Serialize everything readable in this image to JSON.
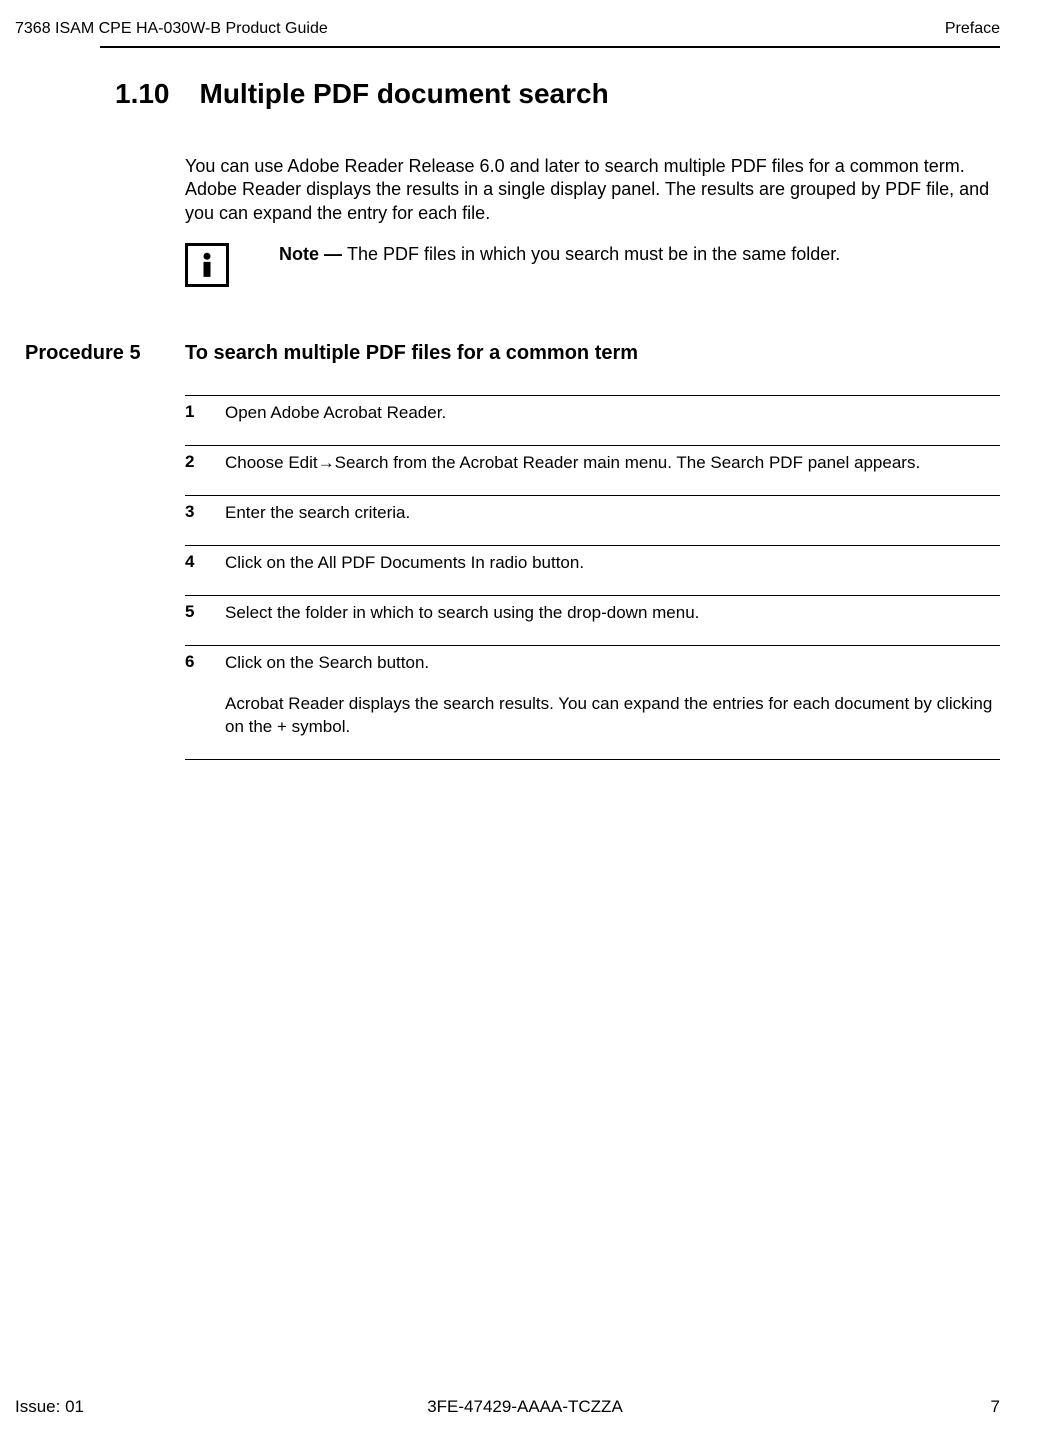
{
  "header": {
    "left": "7368 ISAM CPE HA-030W-B Product Guide",
    "right": "Preface"
  },
  "section": {
    "number": "1.10",
    "title": "Multiple PDF document search"
  },
  "intro": "You can use Adobe Reader Release 6.0 and later to search multiple PDF files for a common term. Adobe Reader displays the results in a single display panel. The results are grouped by PDF file, and you can expand the entry for each file.",
  "note": {
    "label": "Note — ",
    "text": "The PDF files in which you search must be in the same folder."
  },
  "procedure": {
    "label": "Procedure 5",
    "title": "To search multiple PDF files for a common term"
  },
  "steps": [
    {
      "num": "1",
      "text": "Open Adobe Acrobat Reader."
    },
    {
      "num": "2",
      "text": "Choose Edit→Search from the Acrobat Reader main menu. The Search PDF panel appears."
    },
    {
      "num": "3",
      "text": "Enter the search criteria."
    },
    {
      "num": "4",
      "text": "Click on the All PDF Documents In radio button."
    },
    {
      "num": "5",
      "text": "Select the folder in which to search using the drop-down menu."
    },
    {
      "num": "6",
      "text": "Click on the Search button.",
      "extra": "Acrobat Reader displays the search results. You can expand the entries for each document by clicking on the + symbol."
    }
  ],
  "footer": {
    "left": "Issue: 01",
    "center": "3FE-47429-AAAA-TCZZA",
    "right": "7"
  }
}
